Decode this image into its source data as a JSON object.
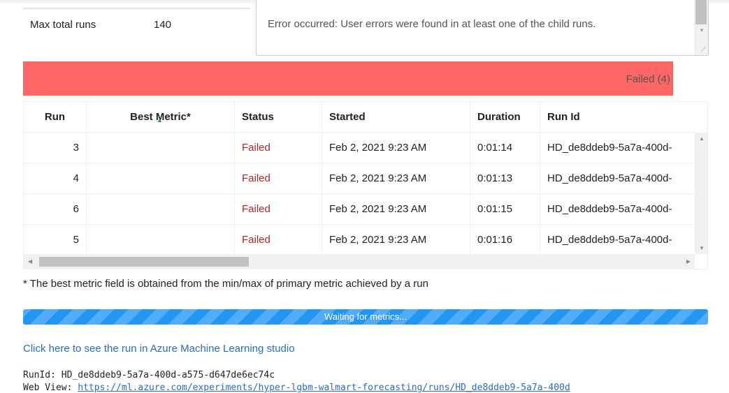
{
  "settings": {
    "max_total_runs_label": "Max total runs",
    "max_total_runs_value": "140"
  },
  "error": {
    "message": "Error occurred: User errors were found in at least one of the child runs."
  },
  "status_bar": {
    "label": "Failed (4)",
    "color": "#ff6666"
  },
  "table": {
    "headers": [
      "Run",
      "Best Metric*",
      "Status",
      "Started",
      "Duration",
      "Run Id"
    ],
    "rows": [
      {
        "run": "3",
        "best": "",
        "status": "Failed",
        "started": "Feb 2, 2021 9:23 AM",
        "duration": "0:01:14",
        "run_id": "HD_de8ddeb9-5a7a-400d-"
      },
      {
        "run": "4",
        "best": "",
        "status": "Failed",
        "started": "Feb 2, 2021 9:23 AM",
        "duration": "0:01:13",
        "run_id": "HD_de8ddeb9-5a7a-400d-"
      },
      {
        "run": "6",
        "best": "",
        "status": "Failed",
        "started": "Feb 2, 2021 9:23 AM",
        "duration": "0:01:15",
        "run_id": "HD_de8ddeb9-5a7a-400d-"
      },
      {
        "run": "5",
        "best": "",
        "status": "Failed",
        "started": "Feb 2, 2021 9:23 AM",
        "duration": "0:01:16",
        "run_id": "HD_de8ddeb9-5a7a-400d-"
      }
    ]
  },
  "footnote": "* The best metric field is obtained from the min/max of primary metric achieved by a run",
  "progress": {
    "label": "Waiting for metrics..."
  },
  "studio_link": "Click here to see the run in Azure Machine Learning studio",
  "output": {
    "run_id_line": "RunId: HD_de8ddeb9-5a7a-400d-a575-d647de6ec74c",
    "web_view_label": "Web View: ",
    "web_view_url": "https://ml.azure.com/experiments/hyper-lgbm-walmart-forecasting/runs/HD_de8ddeb9-5a7a-400d"
  }
}
